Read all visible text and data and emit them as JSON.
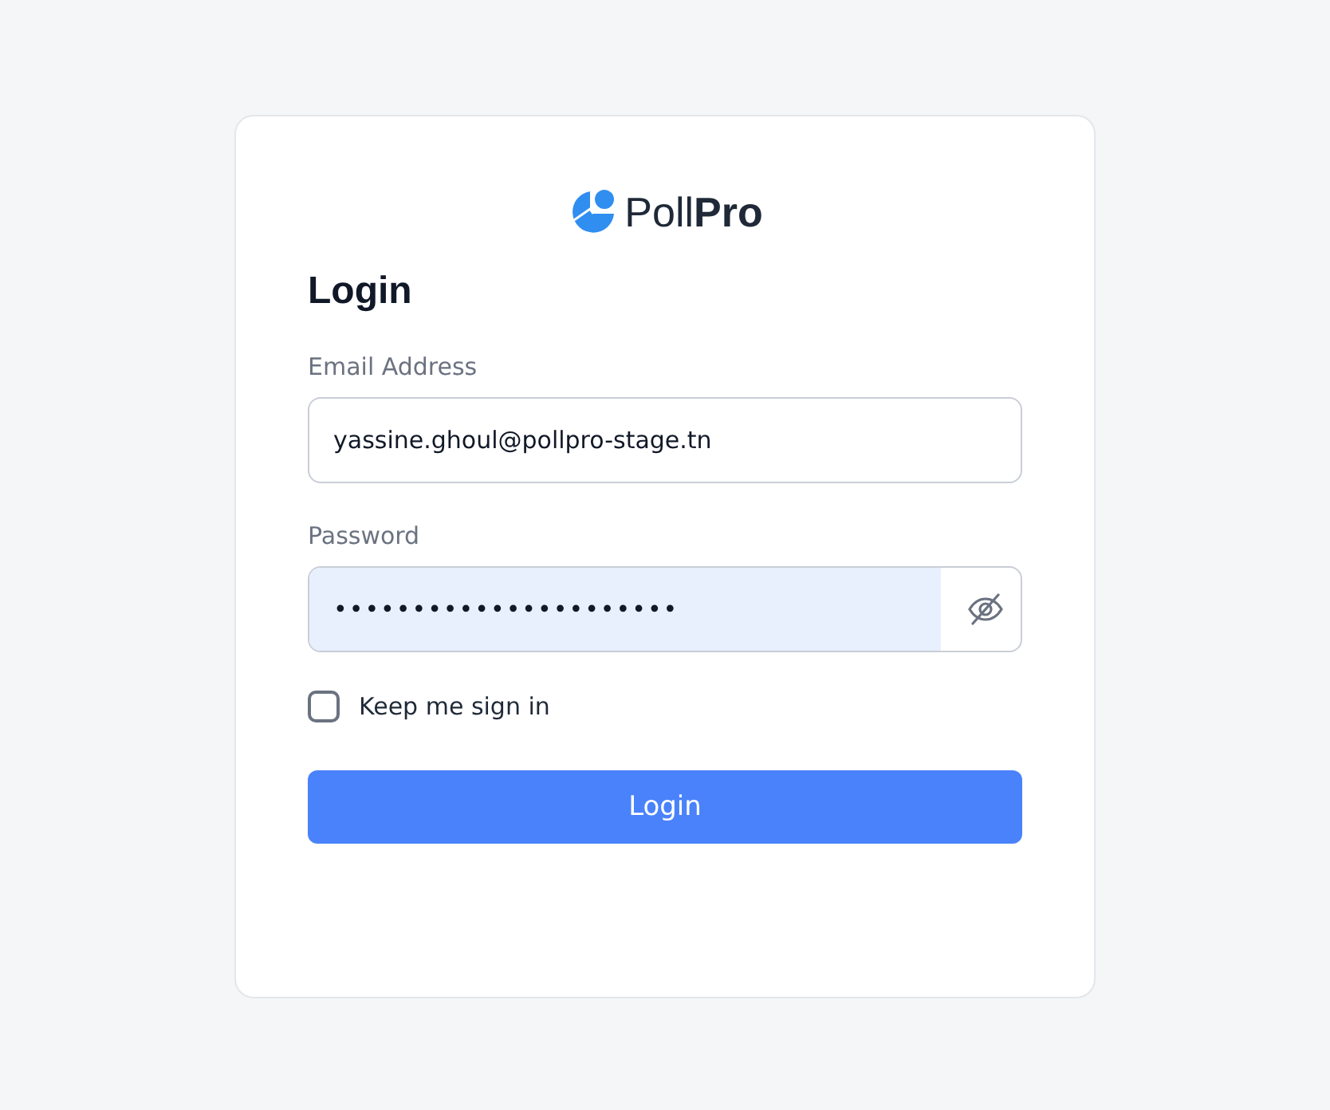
{
  "logo": {
    "text": "Poll**Pro**"
  },
  "title": "Login",
  "fields": [
    {
      "label": "Email Address",
      "value": "yassine.ghoul@pollpro-stage.tn",
      "kind": "text",
      "autofilled": false
    },
    {
      "label": "Password",
      "value": "••••••••••••••••••••••",
      "kind": "password",
      "autofilled": true
    }
  ],
  "remember": {
    "label": "Keep me sign in",
    "checked": false
  },
  "submit": "Login"
}
